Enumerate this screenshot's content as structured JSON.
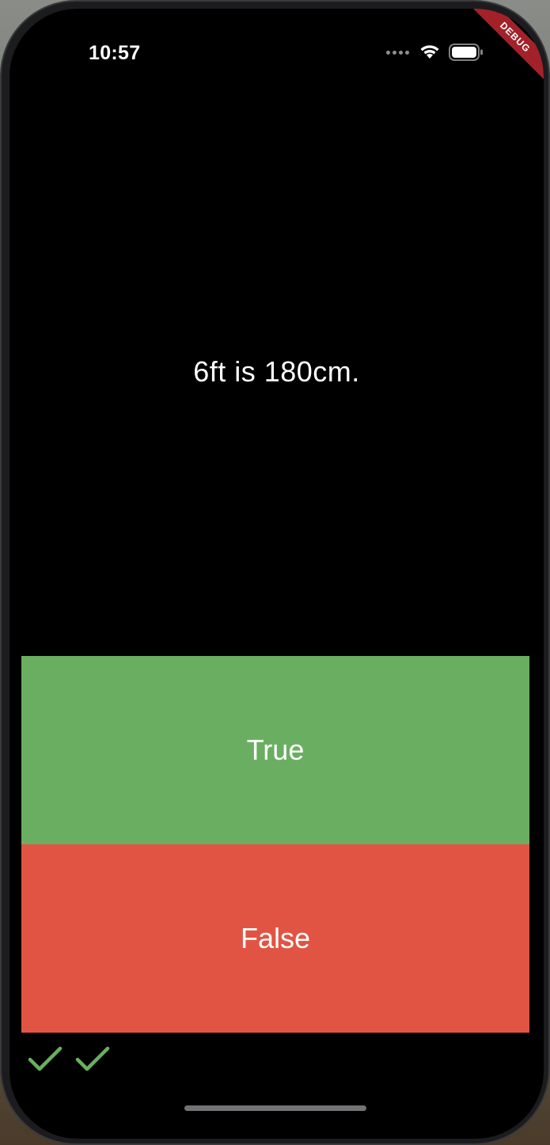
{
  "status_bar": {
    "time": "10:57",
    "icons": [
      "signal-dots-icon",
      "wifi-icon",
      "battery-icon"
    ]
  },
  "debug_banner": {
    "label": "DEBUG",
    "color": "#a3222a"
  },
  "quiz": {
    "question": "6ft is 180cm.",
    "true_label": "True",
    "false_label": "False"
  },
  "score_keeper": {
    "marks": [
      "check-icon",
      "check-icon"
    ],
    "mark_color": "#6aaf61"
  },
  "colors": {
    "true_button": "#6aaf61",
    "false_button": "#e15443",
    "background": "#000000",
    "text": "#ffffff"
  }
}
